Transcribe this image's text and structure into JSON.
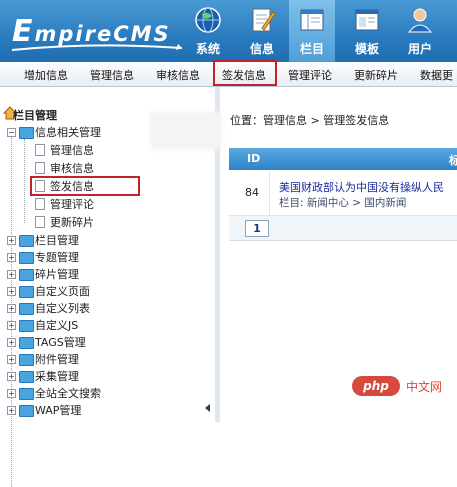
{
  "header": {
    "logo": "EmpireCMS",
    "logo_first": "E",
    "logo_rest": "mpireCMS",
    "nav": [
      {
        "label": "系统",
        "icon": "globe-icon"
      },
      {
        "label": "信息",
        "icon": "pencil-document-icon"
      },
      {
        "label": "栏目",
        "icon": "column-layout-icon",
        "active": true
      },
      {
        "label": "模板",
        "icon": "template-window-icon"
      },
      {
        "label": "用户",
        "icon": "user-icon"
      }
    ]
  },
  "subnav": {
    "items": [
      "增加信息",
      "管理信息",
      "审核信息",
      "签发信息",
      "管理评论",
      "更新碎片",
      "数据更"
    ],
    "highlighted": "签发信息"
  },
  "tree": {
    "title": "栏目管理",
    "group": "信息相关管理",
    "children": [
      "管理信息",
      "审核信息",
      "签发信息",
      "管理评论",
      "更新碎片"
    ],
    "selected": "签发信息",
    "folders": [
      "栏目管理",
      "专题管理",
      "碎片管理",
      "自定义页面",
      "自定义列表",
      "自定义JS",
      "TAGS管理",
      "附件管理",
      "采集管理",
      "全站全文搜索",
      "WAP管理"
    ]
  },
  "main": {
    "breadcrumb_prefix": "位置：",
    "breadcrumb": "管理信息 > 管理签发信息",
    "table": {
      "headers": [
        "ID",
        "标"
      ],
      "rows": [
        {
          "id": "84",
          "title": "美国财政部认为中国没有操纵人民",
          "column": "栏目: 新闻中心 > 国内新闻"
        }
      ]
    },
    "page": "1"
  },
  "watermark": {
    "badge": "php",
    "text": "中文网"
  },
  "colors": {
    "header": "#2a7cc0",
    "highlight_box": "#c0242a",
    "table_header": "#2f82c6"
  }
}
